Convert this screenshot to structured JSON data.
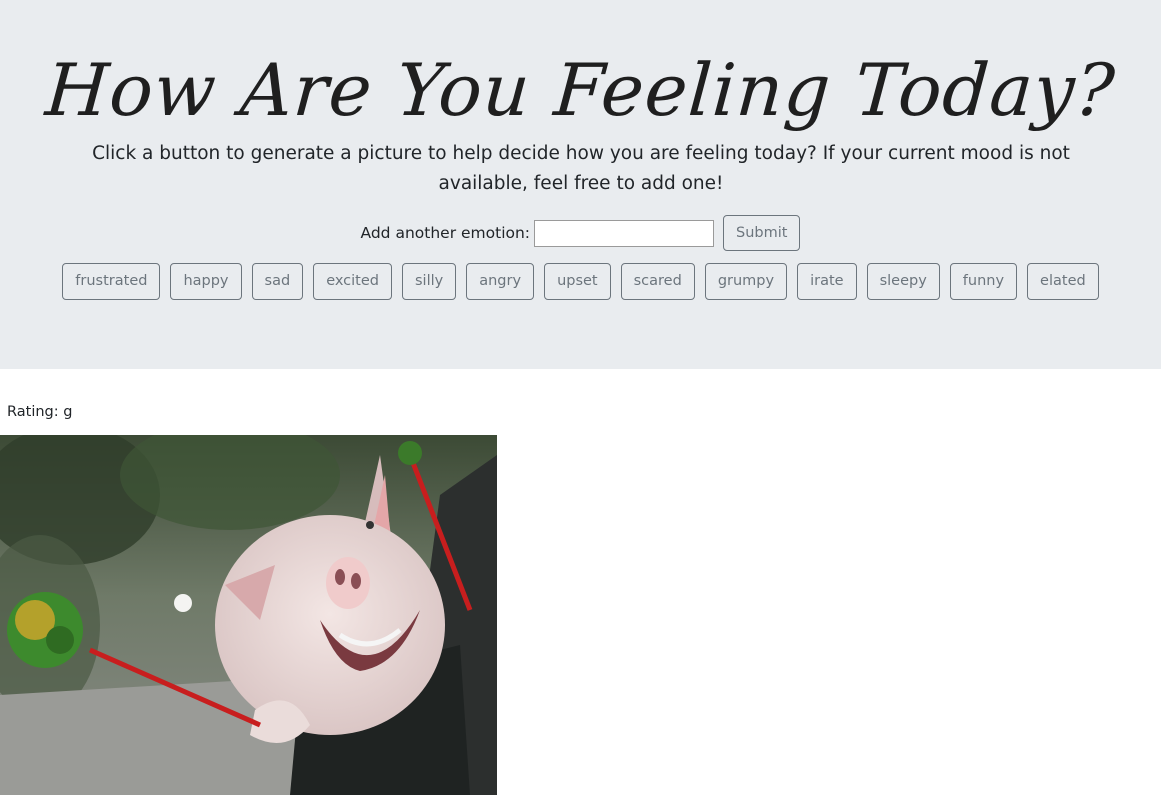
{
  "header": {
    "title": "How Are You Feeling Today?",
    "subtitle": "Click a button to generate a picture to help decide how you are feeling today? If your current mood is not available, feel free to add one!"
  },
  "form": {
    "label": "Add another emotion:",
    "input_value": "",
    "submit_label": "Submit"
  },
  "emotions": [
    "frustrated",
    "happy",
    "sad",
    "excited",
    "silly",
    "angry",
    "upset",
    "scared",
    "grumpy",
    "irate",
    "sleepy",
    "funny",
    "elated"
  ],
  "result": {
    "rating_text": "Rating: g",
    "image_subject": "pig-in-car-gif"
  },
  "colors": {
    "jumbotron_bg": "#e9ecef",
    "button_outline": "#6c757d",
    "text": "#212529"
  }
}
